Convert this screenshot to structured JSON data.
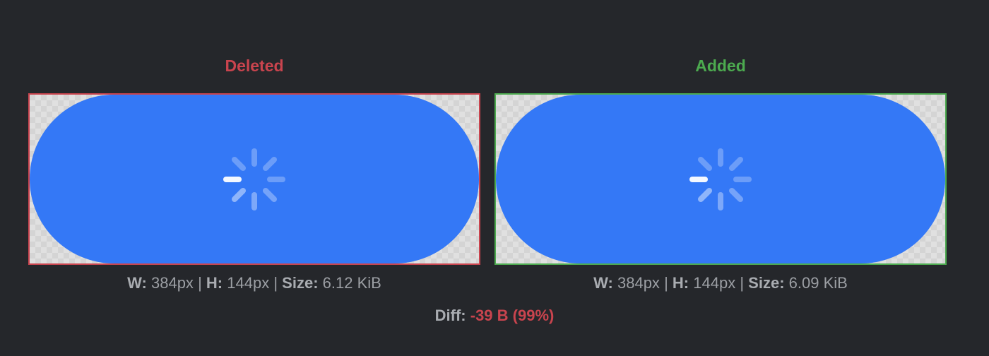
{
  "deleted": {
    "title": "Deleted",
    "width_label": "W:",
    "width_value": "384px",
    "height_label": "H:",
    "height_value": "144px",
    "size_label": "Size:",
    "size_value": "6.12 KiB",
    "separator": "|"
  },
  "added": {
    "title": "Added",
    "width_label": "W:",
    "width_value": "384px",
    "height_label": "H:",
    "height_value": "144px",
    "size_label": "Size:",
    "size_value": "6.09 KiB",
    "separator": "|"
  },
  "diff": {
    "label": "Diff:",
    "value": "-39 B (99%)"
  },
  "colors": {
    "background": "#25272b",
    "deleted": "#c9444e",
    "added": "#4caa4f",
    "button_blue": "#3478f6"
  },
  "icons": {
    "preview_spinner": "loading-spinner-icon"
  }
}
